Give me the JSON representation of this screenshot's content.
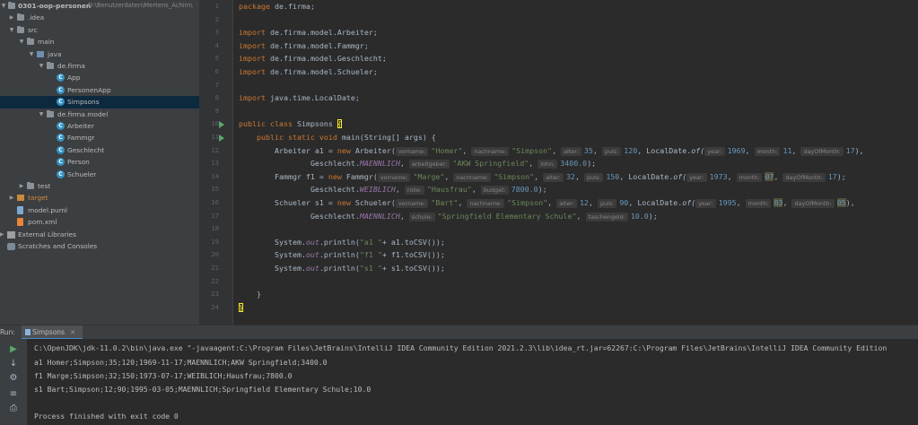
{
  "project": {
    "root_name": "0301-oop-personen",
    "root_path": "D:\\Benutzerdaten\\Mertens_Achim\\",
    "items": [
      {
        "label": "0301-oop-personen",
        "icon": "folder-icon",
        "expanded": true
      },
      {
        "label": ".idea",
        "icon": "folder-icon"
      },
      {
        "label": "src",
        "icon": "folder-icon"
      },
      {
        "label": "main",
        "icon": "folder-icon"
      },
      {
        "label": "java",
        "icon": "source-folder-icon"
      },
      {
        "label": "de.firma",
        "icon": "package-icon"
      },
      {
        "label": "App",
        "icon": "class-icon"
      },
      {
        "label": "PersonenApp",
        "icon": "class-icon"
      },
      {
        "label": "Simpsons",
        "icon": "class-icon"
      },
      {
        "label": "de.firma.model",
        "icon": "package-icon"
      },
      {
        "label": "Arbeiter",
        "icon": "class-icon"
      },
      {
        "label": "Fammgr",
        "icon": "class-icon"
      },
      {
        "label": "Geschlecht",
        "icon": "class-icon"
      },
      {
        "label": "Person",
        "icon": "class-icon"
      },
      {
        "label": "Schueler",
        "icon": "class-icon"
      },
      {
        "label": "test",
        "icon": "folder-icon"
      },
      {
        "label": "target",
        "icon": "folder-icon"
      },
      {
        "label": "model.puml",
        "icon": "file-icon"
      },
      {
        "label": "pom.xml",
        "icon": "file-icon"
      },
      {
        "label": "External Libraries",
        "icon": "library-icon"
      },
      {
        "label": "Scratches and Consoles",
        "icon": "scratch-icon"
      }
    ]
  },
  "editor": {
    "line_numbers": [
      "1",
      "2",
      "3",
      "4",
      "5",
      "6",
      "7",
      "8",
      "9",
      "10",
      "11",
      "12",
      "13",
      "14",
      "15",
      "16",
      "17",
      "18",
      "19",
      "20",
      "21",
      "22",
      "23",
      "24"
    ],
    "lines": {
      "l1_kw": "package",
      "l1_rest": " de.firma;",
      "l3": "de.firma.model.Arbeiter;",
      "l4": "de.firma.model.Fammgr;",
      "l5": "de.firma.model.Geschlecht;",
      "l6": "de.firma.model.Schueler;",
      "l8": "java.time.LocalDate;",
      "import_kw": "import",
      "l10_kw": "public class",
      "l10_name": "Simpsons",
      "l10_brace": "{",
      "l11_kw": "public static void",
      "l11_rest": "main(String[] args) {",
      "l12_type": "Arbeiter a1 = ",
      "l12_new": "new",
      "l12_ctor": "Arbeiter(",
      "hint_vorname": "vorname:",
      "hint_nachname": "nachname:",
      "hint_alter": "alter:",
      "hint_puls": "puls:",
      "hint_year": "year:",
      "hint_month": "month:",
      "hint_day": "dayOfMonth:",
      "hint_arbeitgeber": "arbeitgeber:",
      "hint_lohn": "lohn:",
      "hint_rolle": "rolle:",
      "hint_budget": "budget:",
      "hint_schule": "schule:",
      "hint_taschengeld": "taschengeld:",
      "l12_v1": "\"Homer\"",
      "l12_v2": "\"Simpson\"",
      "l12_alter": "35",
      "l12_puls": "120",
      "l12_ld": "LocalDate.",
      "l12_of": "of(",
      "l12_year": "1969",
      "l12_month": "11",
      "l12_day": "17",
      "l13_g": "Geschlecht.",
      "l13_enum": "MAENNLICH",
      "l13_ag": "\"AKW Springfield\"",
      "l13_lohn": "3400.0",
      "l14_type": "Fammgr f1 = ",
      "l14_ctor": "Fammgr(",
      "l14_v1": "\"Marge\"",
      "l14_v2": "\"Simpson\"",
      "l14_alter": "32",
      "l14_puls": "150",
      "l14_year": "1973",
      "l14_month": "07",
      "l14_day": "17",
      "l15_enum": "WEIBLICH",
      "l15_rolle": "\"Hausfrau\"",
      "l15_budget": "7800.0",
      "l16_type": "Schueler s1 = ",
      "l16_ctor": "Schueler(",
      "l16_v1": "\"Bart\"",
      "l16_v2": "\"Simpson\"",
      "l16_alter": "12",
      "l16_puls": "90",
      "l16_year": "1995",
      "l16_month": "03",
      "l16_day": "05",
      "l17_enum": "MAENNLICH",
      "l17_schule": "\"Springfield Elementary Schule\"",
      "l17_tg": "10.0",
      "sys_a": "System.",
      "sys_out": "out",
      "sys_b": ".println(",
      "l19_str": "\"a1 \"",
      "l19_rest": "+ a1.toCSV());",
      "l20_str": "\"f1 \"",
      "l20_rest": "+ f1.toCSV());",
      "l21_str": "\"s1 \"",
      "l21_rest": "+ s1.toCSV());",
      "l23": "}",
      "l24": "}"
    }
  },
  "run": {
    "label": "Run:",
    "tab": "Simpsons",
    "console": [
      "C:\\OpenJDK\\jdk-11.0.2\\bin\\java.exe \"-javaagent:C:\\Program Files\\JetBrains\\IntelliJ IDEA Community Edition 2021.2.3\\lib\\idea_rt.jar=62267:C:\\Program Files\\JetBrains\\IntelliJ IDEA Community Edition",
      "a1 Homer;Simpson;35;120;1969-11-17;MAENNLICH;AKW Springfield;3400.0",
      "f1 Marge;Simpson;32;150;1973-07-17;WEIBLICH;Hausfrau;7800.0",
      "s1 Bart;Simpson;12;90;1995-03-05;MAENNLICH;Springfield Elementary Schule;10.0",
      "",
      "Process finished with exit code 0"
    ]
  },
  "colors": {
    "keyword": "#cc7832",
    "string": "#6a8759",
    "number": "#6897bb",
    "field": "#9876aa",
    "text": "#a9b7c6",
    "panel": "#3c3f41",
    "editor_bg": "#2b2b2b"
  }
}
